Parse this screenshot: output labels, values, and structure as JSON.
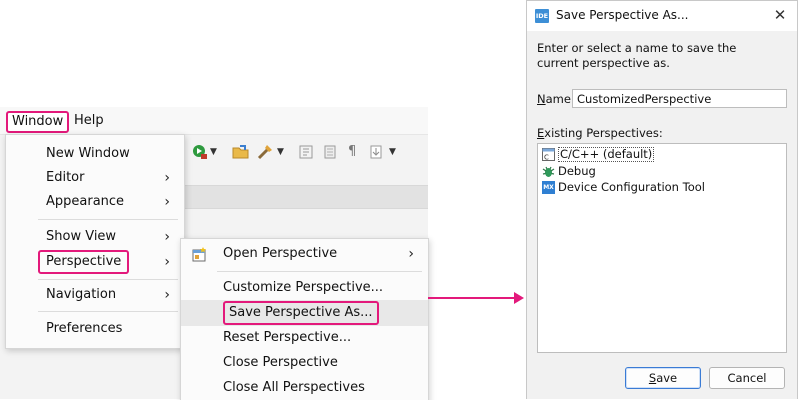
{
  "menubar": {
    "window": "Window",
    "help": "Help"
  },
  "window_menu": {
    "items": [
      {
        "label": "New Window",
        "submenu": false
      },
      {
        "label": "Editor",
        "submenu": true
      },
      {
        "label": "Appearance",
        "submenu": true
      },
      {
        "label": "Show View",
        "submenu": true
      },
      {
        "label": "Perspective",
        "submenu": true
      },
      {
        "label": "Navigation",
        "submenu": true
      },
      {
        "label": "Preferences",
        "submenu": false
      }
    ]
  },
  "perspective_menu": {
    "items": [
      {
        "label": "Open Perspective",
        "submenu": true,
        "icon": "open-perspective-icon"
      },
      {
        "label": "Customize Perspective...",
        "submenu": false
      },
      {
        "label": "Save Perspective As...",
        "submenu": false
      },
      {
        "label": "Reset Perspective...",
        "submenu": false
      },
      {
        "label": "Close Perspective",
        "submenu": false
      },
      {
        "label": "Close All Perspectives",
        "submenu": false
      }
    ]
  },
  "dialog": {
    "title": "Save Perspective As...",
    "app_icon": "IDE",
    "message": "Enter or select a name to save the current perspective as.",
    "name_label_key": "N",
    "name_label_rest": "ame:",
    "name_value": "CustomizedPerspective",
    "existing_label_key": "E",
    "existing_label_rest": "xisting Perspectives:",
    "perspectives": [
      {
        "label": "C/C++ (default)",
        "icon": "cc-perspective-icon"
      },
      {
        "label": "Debug",
        "icon": "debug-bug-icon"
      },
      {
        "label": "Device Configuration Tool",
        "icon": "device-config-icon",
        "icon_text": "MX"
      }
    ],
    "save_key": "S",
    "save_rest": "ave",
    "cancel": "Cancel"
  },
  "colors": {
    "highlight": "#e3197b",
    "accent": "#3a7bd5"
  }
}
